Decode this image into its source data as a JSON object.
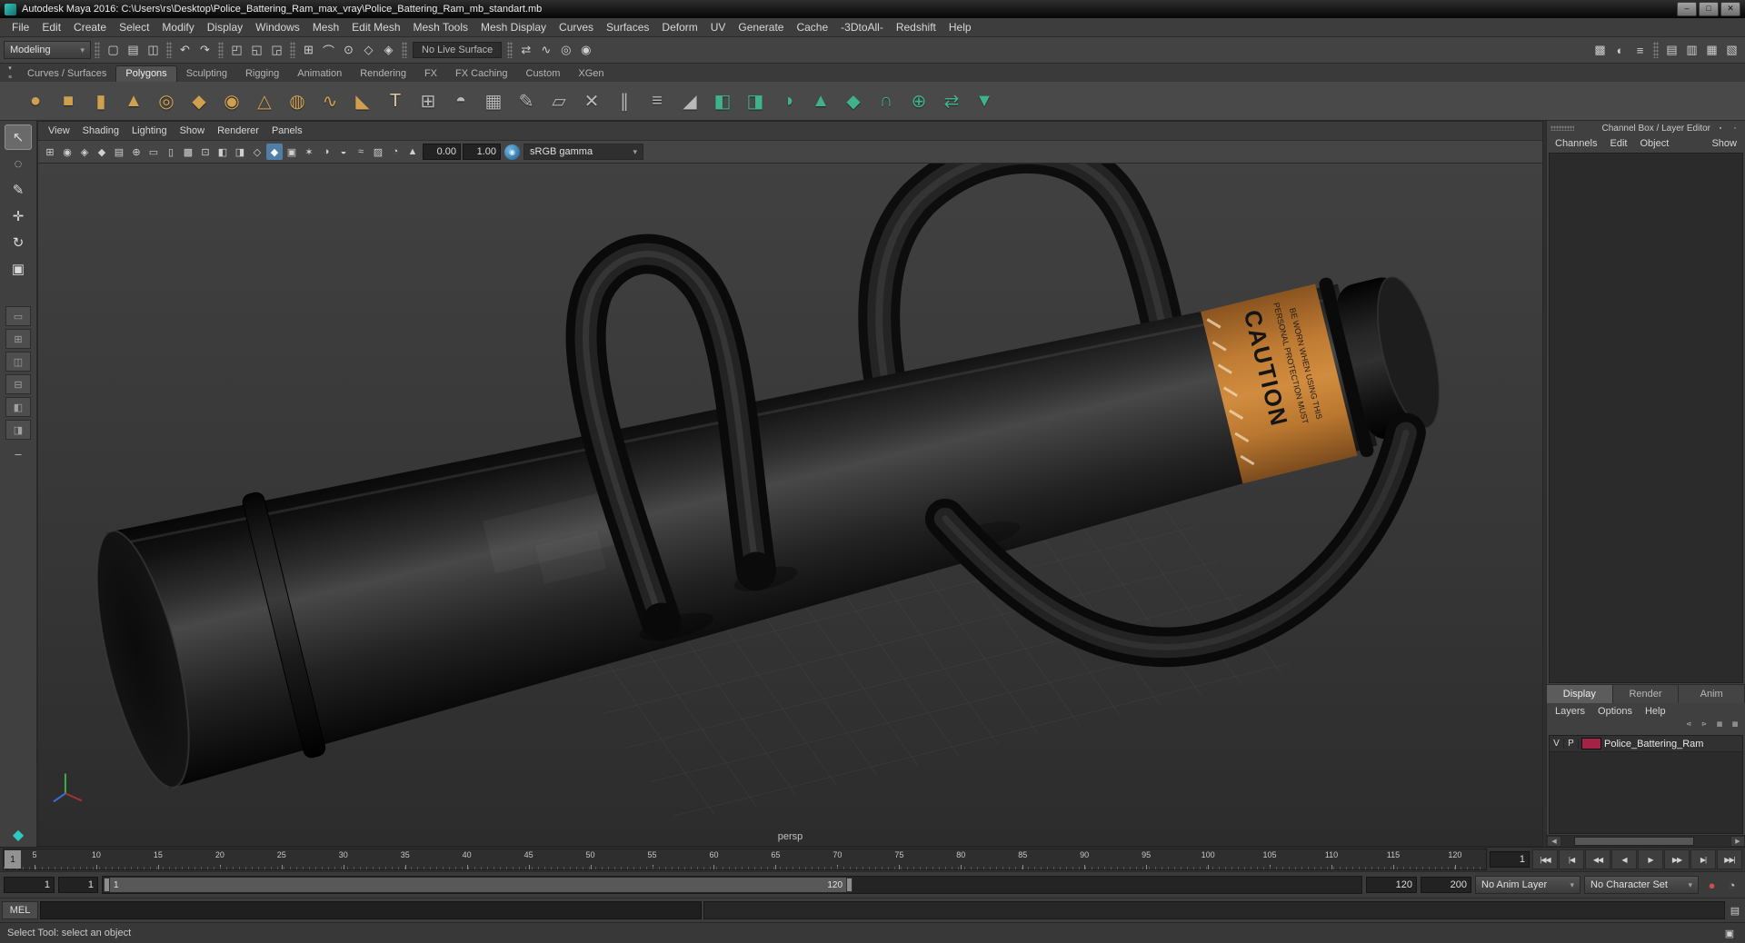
{
  "ui": {
    "caret": "▾",
    "left_arrow": "◀",
    "right_arrow": "▶"
  },
  "window": {
    "title": "Autodesk Maya 2016: C:\\Users\\rs\\Desktop\\Police_Battering_Ram_max_vray\\Police_Battering_Ram_mb_standart.mb",
    "minimize": "–",
    "maximize": "□",
    "close": "✕"
  },
  "menu_bar": [
    "File",
    "Edit",
    "Create",
    "Select",
    "Modify",
    "Display",
    "Windows",
    "Mesh",
    "Edit Mesh",
    "Mesh Tools",
    "Mesh Display",
    "Curves",
    "Surfaces",
    "Deform",
    "UV",
    "Generate",
    "Cache",
    "-3DtoAll-",
    "Redshift",
    "Help"
  ],
  "status_line": {
    "menu_set": "Modeling",
    "live_surface_label": "No Live Surface",
    "file_icons": [
      {
        "name": "new-scene-icon",
        "glyph": "▢"
      },
      {
        "name": "open-scene-icon",
        "glyph": "▤"
      },
      {
        "name": "save-scene-icon",
        "glyph": "◫"
      }
    ],
    "undo_icons": [
      {
        "name": "undo-icon",
        "glyph": "↶"
      },
      {
        "name": "redo-icon",
        "glyph": "↷"
      }
    ],
    "selection_icons": [
      {
        "name": "select-hierarchy-icon",
        "glyph": "◰"
      },
      {
        "name": "select-object-icon",
        "glyph": "◱"
      },
      {
        "name": "select-component-icon",
        "glyph": "◲"
      }
    ],
    "snap_icons": [
      {
        "name": "snap-grid-icon",
        "glyph": "⊞"
      },
      {
        "name": "snap-curve-icon",
        "glyph": "⌒"
      },
      {
        "name": "snap-point-icon",
        "glyph": "⊙"
      },
      {
        "name": "snap-plane-icon",
        "glyph": "◇"
      },
      {
        "name": "make-live-icon",
        "glyph": "◈"
      }
    ],
    "modeling_icons": [
      {
        "name": "symmetry-icon",
        "glyph": "⇄"
      },
      {
        "name": "construction-history-icon",
        "glyph": "∿"
      },
      {
        "name": "highlight-selection-icon",
        "glyph": "◎"
      },
      {
        "name": "soft-select-icon",
        "glyph": "◉"
      }
    ],
    "render_icons": [
      {
        "name": "render-frame-icon",
        "glyph": "▩"
      },
      {
        "name": "ipr-render-icon",
        "glyph": "◐"
      },
      {
        "name": "render-settings-icon",
        "glyph": "≡"
      }
    ],
    "sidebar_icons": [
      {
        "name": "attribute-editor-toggle-icon",
        "glyph": "▤"
      },
      {
        "name": "tool-settings-toggle-icon",
        "glyph": "▥"
      },
      {
        "name": "channel-box-toggle-icon",
        "glyph": "▦"
      },
      {
        "name": "modeling-toolkit-toggle-icon",
        "glyph": "▧"
      }
    ]
  },
  "shelf": {
    "corner_icons": [
      {
        "name": "shelf-tab-selector-icon",
        "glyph": "▾"
      },
      {
        "name": "shelf-menu-icon",
        "glyph": "≡"
      }
    ],
    "tabs": [
      "Curves / Surfaces",
      "Polygons",
      "Sculpting",
      "Rigging",
      "Animation",
      "Rendering",
      "FX",
      "FX Caching",
      "Custom",
      "XGen"
    ],
    "active_tab_index": 1,
    "icons": [
      {
        "name": "poly-sphere-icon",
        "glyph": "●",
        "color": "#cfa050"
      },
      {
        "name": "poly-cube-icon",
        "glyph": "■",
        "color": "#cfa050"
      },
      {
        "name": "poly-cylinder-icon",
        "glyph": "▮",
        "color": "#cfa050"
      },
      {
        "name": "poly-cone-icon",
        "glyph": "▲",
        "color": "#cfa050"
      },
      {
        "name": "poly-torus-icon",
        "glyph": "◎",
        "color": "#cfa050"
      },
      {
        "name": "poly-plane-icon",
        "glyph": "◆",
        "color": "#cfa050"
      },
      {
        "name": "poly-disc-icon",
        "glyph": "◉",
        "color": "#cfa050"
      },
      {
        "name": "poly-pyramid-icon",
        "glyph": "△",
        "color": "#cfa050"
      },
      {
        "name": "poly-pipe-icon",
        "glyph": "◍",
        "color": "#cfa050"
      },
      {
        "name": "poly-helix-icon",
        "glyph": "∿",
        "color": "#cfa050"
      },
      {
        "name": "poly-prism-icon",
        "glyph": "◣",
        "color": "#cfa050"
      },
      {
        "name": "poly-text-icon",
        "glyph": "T",
        "color": "#d8c79b"
      },
      {
        "name": "lattice-icon",
        "glyph": "⊞",
        "color": "#b9b9b9"
      },
      {
        "name": "textured-sphere-icon",
        "glyph": "◓",
        "color": "#b9b9b9"
      },
      {
        "name": "uv-grid-icon",
        "glyph": "▦",
        "color": "#b9b9b9"
      },
      {
        "name": "pencil-curve-icon",
        "glyph": "✎",
        "color": "#b9b9b9"
      },
      {
        "name": "quad-draw-icon",
        "glyph": "▱",
        "color": "#b9b9b9"
      },
      {
        "name": "multi-cut-icon",
        "glyph": "✕",
        "color": "#b9b9b9"
      },
      {
        "name": "insert-edge-loop-icon",
        "glyph": "∥",
        "color": "#b9b9b9"
      },
      {
        "name": "offset-edge-loop-icon",
        "glyph": "≡",
        "color": "#b9b9b9"
      },
      {
        "name": "crease-tool-icon",
        "glyph": "◢",
        "color": "#b9b9b9"
      },
      {
        "name": "combine-icon",
        "glyph": "◧",
        "color": "#3fb28b"
      },
      {
        "name": "separate-icon",
        "glyph": "◨",
        "color": "#3fb28b"
      },
      {
        "name": "smooth-icon",
        "glyph": "◑",
        "color": "#3fb28b"
      },
      {
        "name": "extrude-icon",
        "glyph": "▲",
        "color": "#3fb28b"
      },
      {
        "name": "bevel-icon",
        "glyph": "◆",
        "color": "#3fb28b"
      },
      {
        "name": "bridge-icon",
        "glyph": "∩",
        "color": "#3fb28b"
      },
      {
        "name": "boolean-icon",
        "glyph": "⊕",
        "color": "#3fb28b"
      },
      {
        "name": "mirror-icon",
        "glyph": "⇄",
        "color": "#3fb28b"
      },
      {
        "name": "reduce-icon",
        "glyph": "▼",
        "color": "#3fb28b"
      }
    ]
  },
  "toolbox": {
    "tools": [
      {
        "name": "select-tool",
        "glyph": "↖",
        "active": true
      },
      {
        "name": "lasso-tool",
        "glyph": "◌"
      },
      {
        "name": "paint-select-tool",
        "glyph": "✎"
      },
      {
        "name": "move-tool",
        "glyph": "✛"
      },
      {
        "name": "rotate-tool",
        "glyph": "↻"
      },
      {
        "name": "scale-tool",
        "glyph": "▣"
      }
    ],
    "layout_buttons": [
      {
        "name": "layout-single-persp-button",
        "glyph": "▭"
      },
      {
        "name": "layout-four-view-button",
        "glyph": "⊞"
      },
      {
        "name": "layout-persp-outliner-button",
        "glyph": "◫"
      },
      {
        "name": "layout-persp-graph-button",
        "glyph": "⊟"
      },
      {
        "name": "layout-hypershade-button",
        "glyph": "◧"
      },
      {
        "name": "layout-uv-editor-button",
        "glyph": "◨"
      }
    ],
    "collapse_glyph": "–",
    "footer_glyph": "◆"
  },
  "viewport": {
    "menus": [
      "View",
      "Shading",
      "Lighting",
      "Show",
      "Renderer",
      "Panels"
    ],
    "toolbar_icons": [
      {
        "name": "grid-toggle-icon",
        "glyph": "⊞"
      },
      {
        "name": "camera-icon",
        "glyph": "◉"
      },
      {
        "name": "lock-camera-icon",
        "glyph": "◈"
      },
      {
        "name": "bookmark-icon",
        "glyph": "◆"
      },
      {
        "name": "image-plane-icon",
        "glyph": "▤"
      },
      {
        "name": "two-d-pan-zoom-icon",
        "glyph": "⊕"
      },
      {
        "name": "film-gate-icon",
        "glyph": "▭"
      },
      {
        "name": "resolution-gate-icon",
        "glyph": "▯"
      },
      {
        "name": "gate-mask-icon",
        "glyph": "▩"
      },
      {
        "name": "field-chart-icon",
        "glyph": "⊡"
      },
      {
        "name": "safe-action-icon",
        "glyph": "◧"
      },
      {
        "name": "safe-title-icon",
        "glyph": "◨"
      },
      {
        "name": "wireframe-icon",
        "glyph": "◇"
      },
      {
        "name": "shaded-icon",
        "glyph": "◆",
        "active": true
      },
      {
        "name": "textured-icon",
        "glyph": "▣"
      },
      {
        "name": "lights-icon",
        "glyph": "✶"
      },
      {
        "name": "shadows-icon",
        "glyph": "◑"
      },
      {
        "name": "ssao-icon",
        "glyph": "◒"
      },
      {
        "name": "motion-blur-icon",
        "glyph": "≈"
      },
      {
        "name": "multisample-icon",
        "glyph": "▨"
      },
      {
        "name": "xray-icon",
        "glyph": "◔"
      },
      {
        "name": "isolate-select-icon",
        "glyph": "▲"
      }
    ],
    "exposure_value": "0.00",
    "gamma_value": "1.00",
    "color_mgmt_glyph": "◉",
    "gamma_mode": "sRGB gamma",
    "camera_label": "persp",
    "label": {
      "caution": "CAUTION",
      "line1": "PERSONAL PROTECTION MUST",
      "line2": "BE WORN WHEN USING THIS"
    }
  },
  "channel_box": {
    "header": "Channel Box / Layer Editor",
    "corner_icons": [
      {
        "name": "channel-settings-icon",
        "glyph": "▪"
      },
      {
        "name": "pin-panel-icon",
        "glyph": "▫"
      }
    ],
    "menus": [
      "Channels",
      "Edit",
      "Object",
      "Show"
    ]
  },
  "layer_editor": {
    "tabs": [
      "Display",
      "Render",
      "Anim"
    ],
    "active_tab_index": 0,
    "menus": [
      "Layers",
      "Options",
      "Help"
    ],
    "toolbar_icons": [
      {
        "name": "move-layer-up-icon",
        "glyph": "⊲"
      },
      {
        "name": "move-layer-down-icon",
        "glyph": "⊳"
      },
      {
        "name": "empty-layer-icon",
        "glyph": "▦"
      },
      {
        "name": "layer-from-selected-icon",
        "glyph": "▩"
      }
    ],
    "layers": [
      {
        "visibility": "V",
        "playback": "P",
        "color": "#a32246",
        "name": "Police_Battering_Ram"
      }
    ]
  },
  "timeline": {
    "ticks": [
      "5",
      "10",
      "15",
      "20",
      "25",
      "30",
      "35",
      "40",
      "45",
      "50",
      "55",
      "60",
      "65",
      "70",
      "75",
      "80",
      "85",
      "90",
      "95",
      "100",
      "105",
      "110",
      "115",
      "120"
    ],
    "current_frame": "1",
    "current_frame_field": "1",
    "playback_icons": [
      {
        "name": "go-to-start-button",
        "glyph": "|◀◀"
      },
      {
        "name": "step-back-frame-button",
        "glyph": "|◀"
      },
      {
        "name": "step-back-key-button",
        "glyph": "◀◀"
      },
      {
        "name": "play-backwards-button",
        "glyph": "◀"
      },
      {
        "name": "play-forwards-button",
        "glyph": "▶"
      },
      {
        "name": "step-forward-key-button",
        "glyph": "▶▶"
      },
      {
        "name": "step-forward-frame-button",
        "glyph": "▶|"
      },
      {
        "name": "go-to-end-button",
        "glyph": "▶▶|"
      }
    ]
  },
  "range_slider": {
    "animation_start": "1",
    "playback_start": "1",
    "range_start_label": "1",
    "range_end_label": "120",
    "playback_end": "120",
    "animation_end": "200",
    "anim_layer": "No Anim Layer",
    "character_set": "No Character Set",
    "icons": [
      {
        "name": "auto-keyframe-icon",
        "glyph": "●",
        "color": "#c95050"
      },
      {
        "name": "animation-preferences-icon",
        "glyph": "◔",
        "color": "#bfbfbf"
      }
    ]
  },
  "command_line": {
    "label": "MEL",
    "icon_glyph": "▤"
  },
  "help_line": {
    "text": "Select Tool: select an object",
    "icon_glyph": "▣"
  }
}
